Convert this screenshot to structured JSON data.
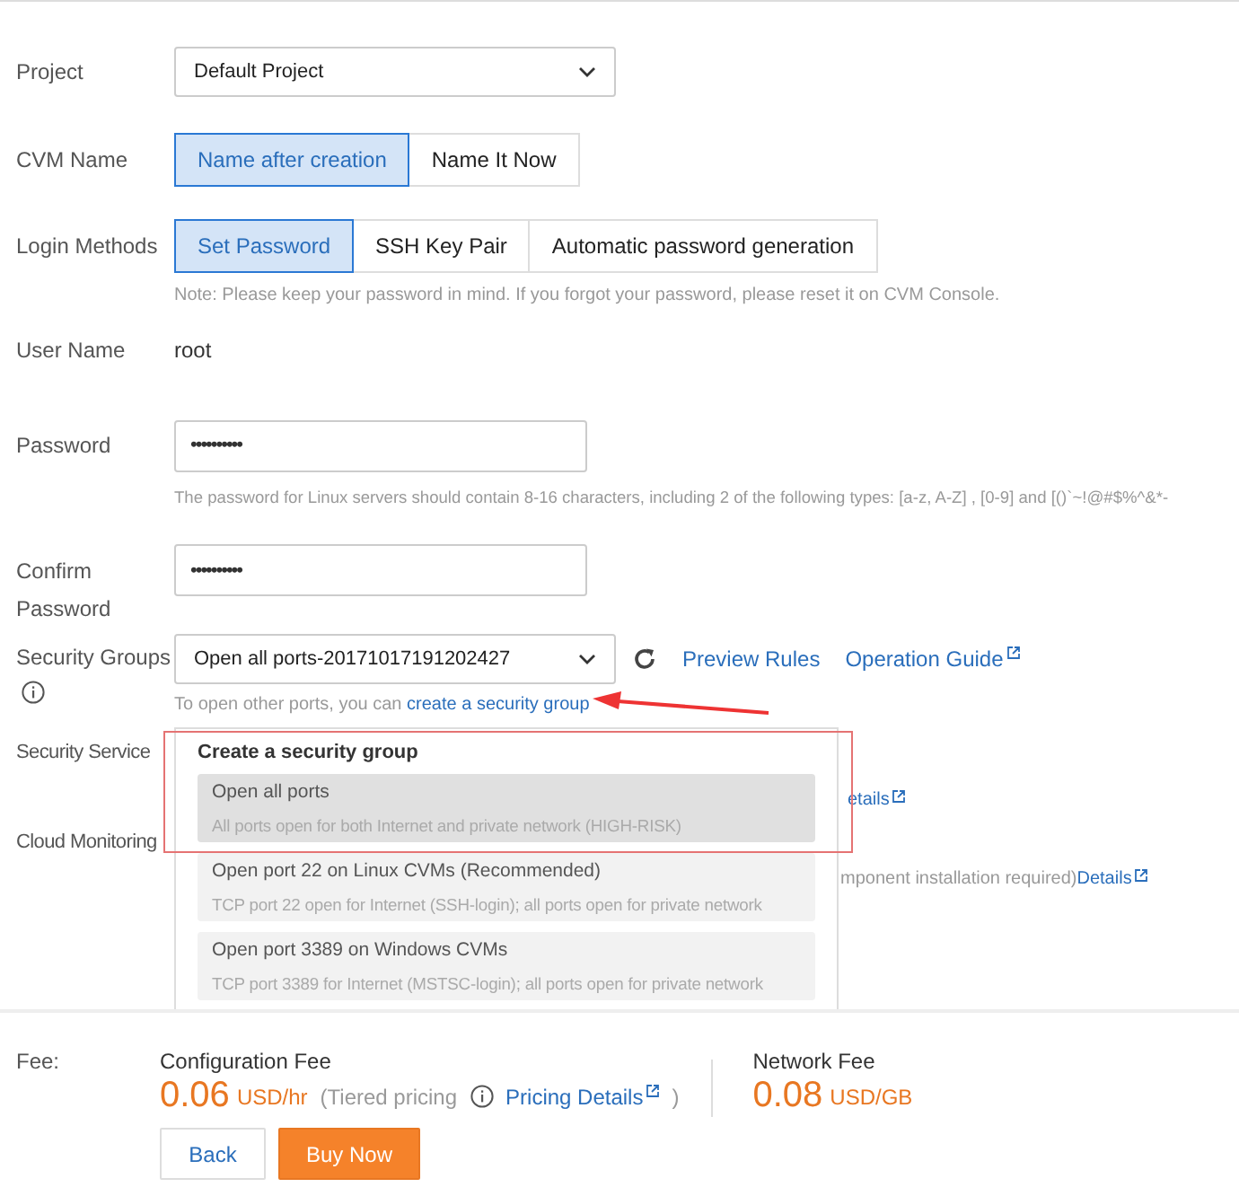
{
  "project": {
    "label": "Project",
    "value": "Default Project"
  },
  "cvm_name": {
    "label": "CVM Name",
    "options": [
      {
        "label": "Name after creation",
        "selected": true
      },
      {
        "label": "Name It Now",
        "selected": false
      }
    ]
  },
  "login_methods": {
    "label": "Login Methods",
    "options": [
      {
        "label": "Set Password",
        "selected": true
      },
      {
        "label": "SSH Key Pair",
        "selected": false
      },
      {
        "label": "Automatic password generation",
        "selected": false
      }
    ],
    "note": "Note: Please keep your password in mind. If you forgot your password, please reset it on CVM Console."
  },
  "user_name": {
    "label": "User Name",
    "value": "root"
  },
  "password": {
    "label": "Password",
    "value": "••••••••••",
    "hint": "The password for Linux servers should contain 8-16 characters, including 2 of the following types: [a-z, A-Z] , [0-9] and [()`~!@#$%^&*-"
  },
  "confirm_password": {
    "label": "Confirm Password",
    "value": "••••••••••"
  },
  "security_groups": {
    "label": "Security Groups",
    "value": "Open all ports-20171017191202427",
    "preview_link": "Preview Rules",
    "guide_link": "Operation Guide",
    "hint": "To open other ports, you can",
    "hint_link": "create a security group"
  },
  "security_service": {
    "label": "Security Service",
    "link_fragment": "etails"
  },
  "cloud_monitoring": {
    "label": "Cloud Monitoring",
    "text_fragment": "mponent installation required)",
    "link": "Details"
  },
  "dropdown": {
    "title": "Create a security group",
    "items": [
      {
        "title": "Open all ports",
        "description": "All ports open for both Internet and private network (HIGH-RISK)",
        "selected": true
      },
      {
        "title": "Open port 22 on Linux CVMs (Recommended)",
        "description": "TCP port 22 open for Internet (SSH-login); all ports open for private network",
        "selected": false
      },
      {
        "title": "Open port 3389 on Windows CVMs",
        "description": "TCP port 3389 for Internet (MSTSC-login); all ports open for private network",
        "selected": false
      }
    ]
  },
  "fee": {
    "label": "Fee:",
    "config_title": "Configuration Fee",
    "config_price": "0.06",
    "config_unit": "USD/hr",
    "tiered": "(Tiered pricing",
    "pricing_link": "Pricing Details",
    "close_paren": ")",
    "network_title": "Network Fee",
    "network_price": "0.08",
    "network_unit": "USD/GB"
  },
  "buttons": [
    {
      "label": "Back",
      "kind": "secondary"
    },
    {
      "label": "Buy Now",
      "kind": "primary"
    }
  ]
}
